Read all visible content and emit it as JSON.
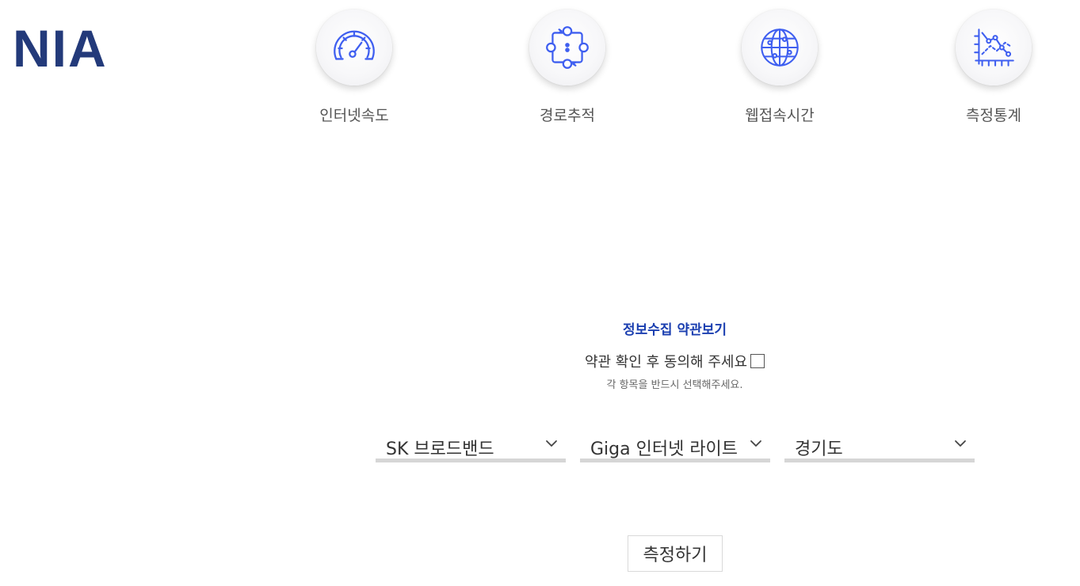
{
  "header": {
    "logo_text": "NIA"
  },
  "nav": {
    "items": [
      {
        "label": "인터넷속도",
        "icon": "speedometer-icon"
      },
      {
        "label": "경로추적",
        "icon": "route-trace-icon"
      },
      {
        "label": "웹접속시간",
        "icon": "globe-network-icon"
      },
      {
        "label": "측정통계",
        "icon": "statistics-graph-icon"
      }
    ]
  },
  "terms": {
    "link_label": "정보수집 약관보기",
    "agree_label": "약관 확인 후 동의해 주세요",
    "agree_checked": false,
    "notice": "각 항목을 반드시 선택해주세요."
  },
  "selects": {
    "provider": {
      "value": "SK 브로드밴드"
    },
    "plan": {
      "value": "Giga 인터넷 라이트"
    },
    "region": {
      "value": "경기도"
    }
  },
  "actions": {
    "measure_label": "측정하기"
  },
  "colors": {
    "brand": "#233a7a",
    "icon_blue": "#3f5ff0",
    "link_blue": "#1b3fb0",
    "select_underline": "#d6d6d6"
  }
}
